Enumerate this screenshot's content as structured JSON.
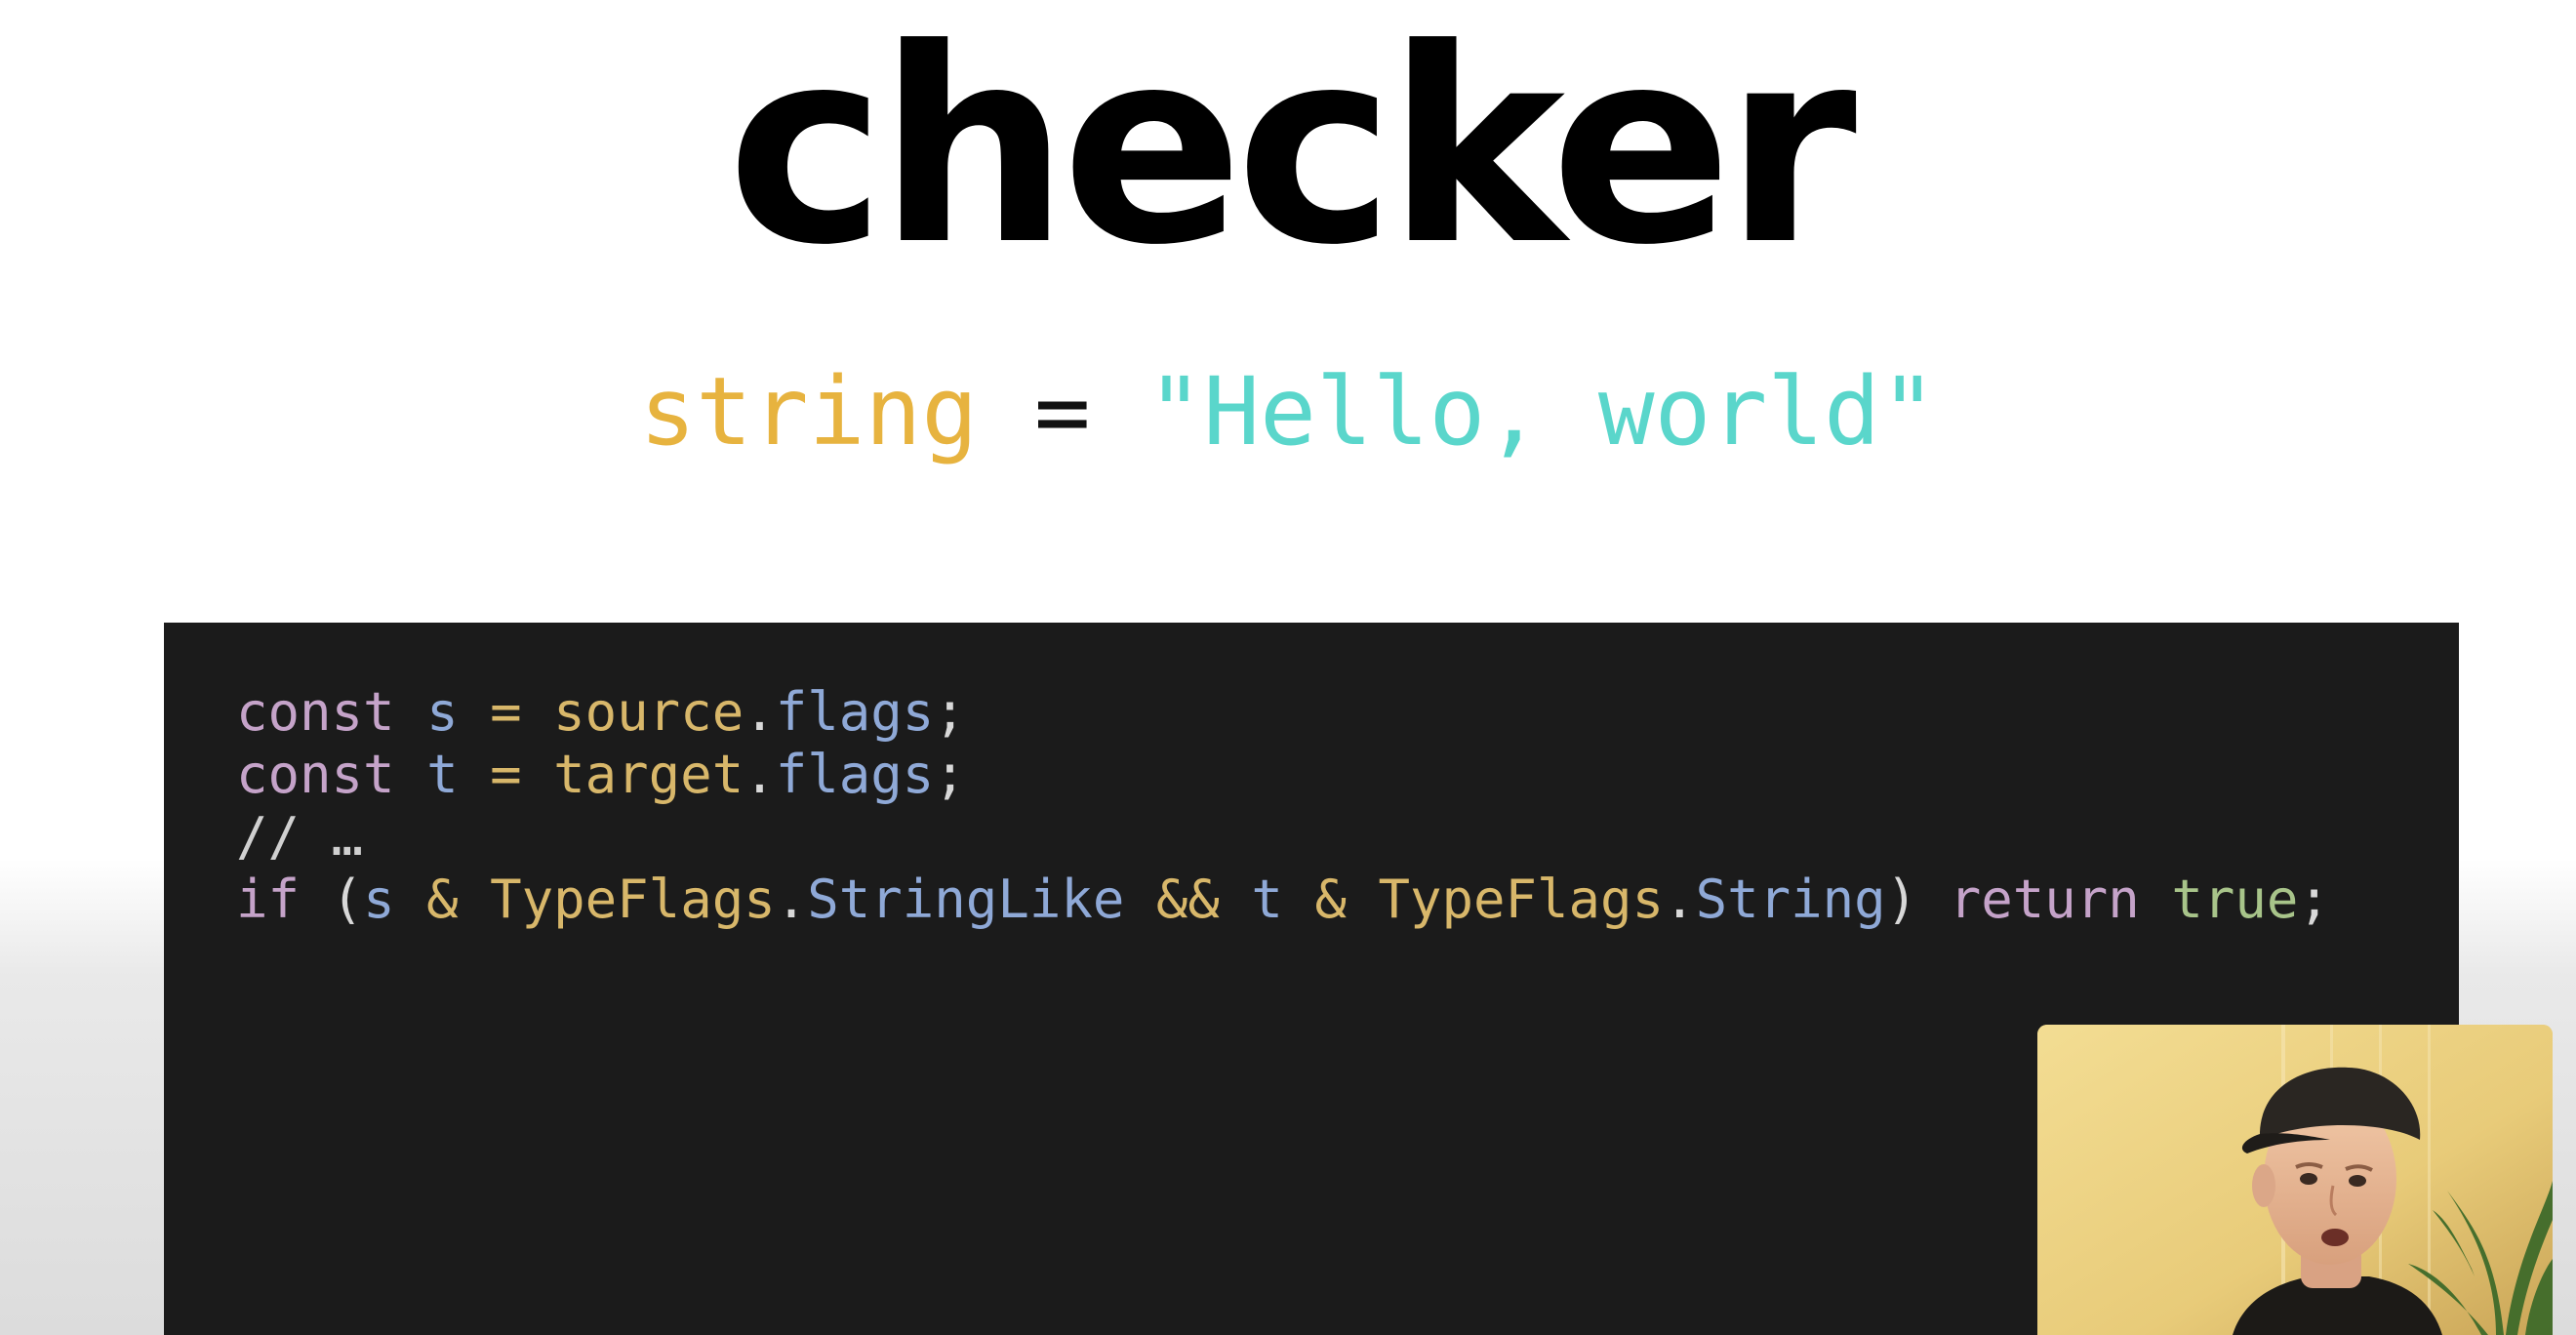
{
  "title": "checker",
  "assignment": {
    "type": "string",
    "operator": "=",
    "value": "\"Hello, world\""
  },
  "code": {
    "lines": [
      [
        {
          "text": "const",
          "role": "keyword"
        },
        {
          "text": " ",
          "role": "plain"
        },
        {
          "text": "s",
          "role": "variable"
        },
        {
          "text": " ",
          "role": "plain"
        },
        {
          "text": "=",
          "role": "operator"
        },
        {
          "text": " ",
          "role": "plain"
        },
        {
          "text": "source",
          "role": "object"
        },
        {
          "text": ".",
          "role": "punctuation"
        },
        {
          "text": "flags",
          "role": "property"
        },
        {
          "text": ";",
          "role": "punctuation"
        }
      ],
      [
        {
          "text": "const",
          "role": "keyword"
        },
        {
          "text": " ",
          "role": "plain"
        },
        {
          "text": "t",
          "role": "variable"
        },
        {
          "text": " ",
          "role": "plain"
        },
        {
          "text": "=",
          "role": "operator"
        },
        {
          "text": " ",
          "role": "plain"
        },
        {
          "text": "target",
          "role": "object"
        },
        {
          "text": ".",
          "role": "punctuation"
        },
        {
          "text": "flags",
          "role": "property"
        },
        {
          "text": ";",
          "role": "punctuation"
        }
      ],
      [
        {
          "text": "// …",
          "role": "comment"
        }
      ],
      [
        {
          "text": "if",
          "role": "keyword"
        },
        {
          "text": " (",
          "role": "punctuation"
        },
        {
          "text": "s",
          "role": "variable"
        },
        {
          "text": " ",
          "role": "plain"
        },
        {
          "text": "&",
          "role": "operator"
        },
        {
          "text": " ",
          "role": "plain"
        },
        {
          "text": "TypeFlags",
          "role": "object"
        },
        {
          "text": ".",
          "role": "punctuation"
        },
        {
          "text": "StringLike",
          "role": "property"
        },
        {
          "text": " ",
          "role": "plain"
        },
        {
          "text": "&&",
          "role": "operator"
        },
        {
          "text": " ",
          "role": "plain"
        },
        {
          "text": "t",
          "role": "variable"
        },
        {
          "text": " ",
          "role": "plain"
        },
        {
          "text": "&",
          "role": "operator"
        },
        {
          "text": " ",
          "role": "plain"
        },
        {
          "text": "TypeFlags",
          "role": "object"
        },
        {
          "text": ".",
          "role": "punctuation"
        },
        {
          "text": "String",
          "role": "property"
        },
        {
          "text": ") ",
          "role": "punctuation"
        },
        {
          "text": "return",
          "role": "keyword"
        },
        {
          "text": " ",
          "role": "plain"
        },
        {
          "text": "true",
          "role": "boolean"
        },
        {
          "text": ";",
          "role": "punctuation"
        }
      ]
    ]
  },
  "colors": {
    "code_background": "#1b1b1b",
    "assignment_type": "#e7b33f",
    "assignment_string": "#5ad6cb",
    "keyword": "#c5a3c9",
    "variable": "#8fa9d7",
    "object": "#d8b76a",
    "property": "#8fa9d7",
    "boolean": "#a8c48a"
  },
  "webcam": {
    "icon": "presenter-video"
  }
}
